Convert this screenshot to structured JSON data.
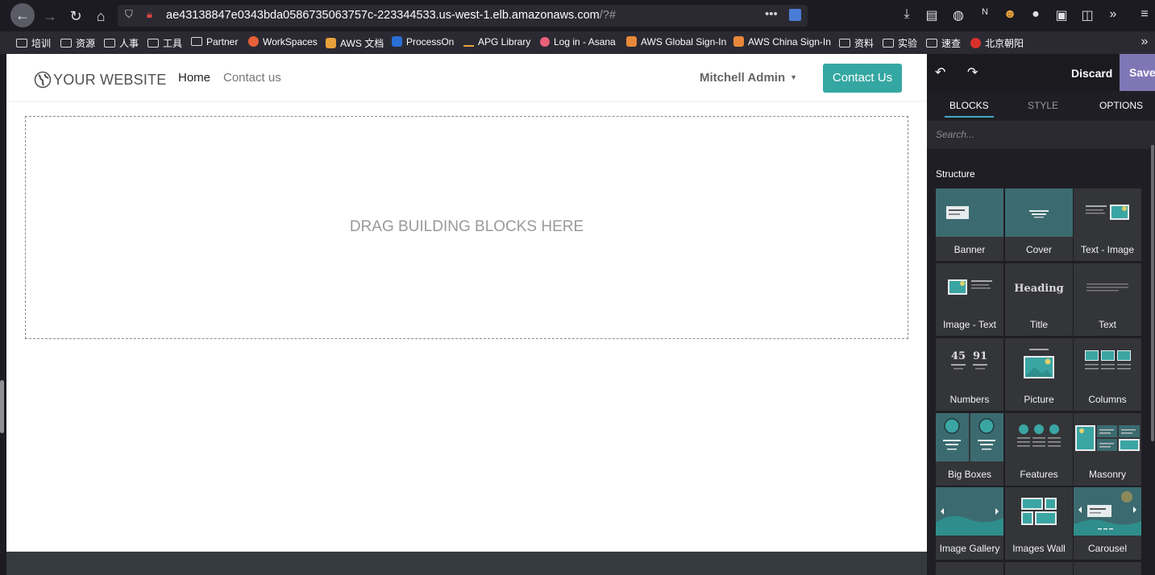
{
  "browser": {
    "url_host": "ae43138847e0343bda0586735063757c-223344533.us-west-1.elb.amazonaws.com",
    "url_path": "/?#",
    "bookmarks": [
      {
        "label": "培训",
        "icon": "folder-icon"
      },
      {
        "label": "资源",
        "icon": "folder-icon"
      },
      {
        "label": "人事",
        "icon": "folder-icon"
      },
      {
        "label": "工具",
        "icon": "folder-icon"
      },
      {
        "label": "Partner",
        "icon": "folder-icon"
      },
      {
        "label": "WorkSpaces",
        "icon": "workspaces-icon"
      },
      {
        "label": "AWS 文档",
        "icon": "aws-docs-icon"
      },
      {
        "label": "ProcessOn",
        "icon": "processon-icon"
      },
      {
        "label": "APG Library",
        "icon": "aws-icon"
      },
      {
        "label": "Log in - Asana",
        "icon": "asana-icon"
      },
      {
        "label": "AWS Global Sign-In",
        "icon": "aws-cube-icon"
      },
      {
        "label": "AWS China Sign-In",
        "icon": "aws-cube-icon"
      },
      {
        "label": "资料",
        "icon": "folder-icon"
      },
      {
        "label": "实验",
        "icon": "folder-icon"
      },
      {
        "label": "速查",
        "icon": "folder-icon"
      },
      {
        "label": "北京朝阳",
        "icon": "weibo-icon"
      }
    ]
  },
  "site": {
    "logo": "YOUR WEBSITE",
    "nav": [
      "Home",
      "Contact us"
    ],
    "user": "Mitchell Admin",
    "cta": "Contact Us",
    "dropzone": "DRAG BUILDING BLOCKS HERE"
  },
  "editor": {
    "discard": "Discard",
    "save": "Save",
    "tabs": [
      "BLOCKS",
      "STYLE",
      "OPTIONS"
    ],
    "search_placeholder": "Search...",
    "section": "Structure",
    "blocks": [
      "Banner",
      "Cover",
      "Text - Image",
      "Image - Text",
      "Title",
      "Text",
      "Numbers",
      "Picture",
      "Columns",
      "Big Boxes",
      "Features",
      "Masonry",
      "Image Gallery",
      "Images Wall",
      "Carousel"
    ],
    "thumb_text": {
      "heading": "Heading",
      "num1": "45",
      "num2": "91"
    }
  },
  "colors": {
    "teal": "#35a7a2",
    "save": "#7f76b5",
    "thumb_bg": "#3b6b70",
    "accent": "#42a8c4"
  }
}
